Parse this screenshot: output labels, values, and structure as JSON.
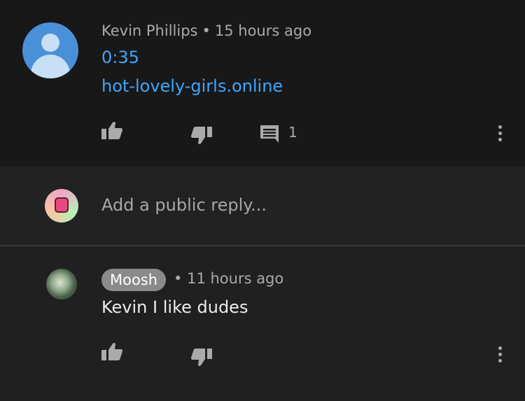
{
  "top_comment": {
    "author": "Kevin Phillips",
    "separator": "•",
    "timestamp": "15 hours ago",
    "lines": [
      "0:35",
      "hot-lovely-girls.online"
    ],
    "reply_count": "1"
  },
  "reply_box": {
    "placeholder": "Add a public reply..."
  },
  "reply": {
    "author": "Moosh",
    "separator": "•",
    "timestamp": "11 hours ago",
    "text": "Kevin I like dudes"
  },
  "colors": {
    "link": "#3ea6ff",
    "avatar_default": "#4a90d9",
    "badge": "#8a8a8a"
  },
  "icons": [
    "thumb-up-icon",
    "thumb-down-icon",
    "reply-icon",
    "more-vert-icon"
  ]
}
